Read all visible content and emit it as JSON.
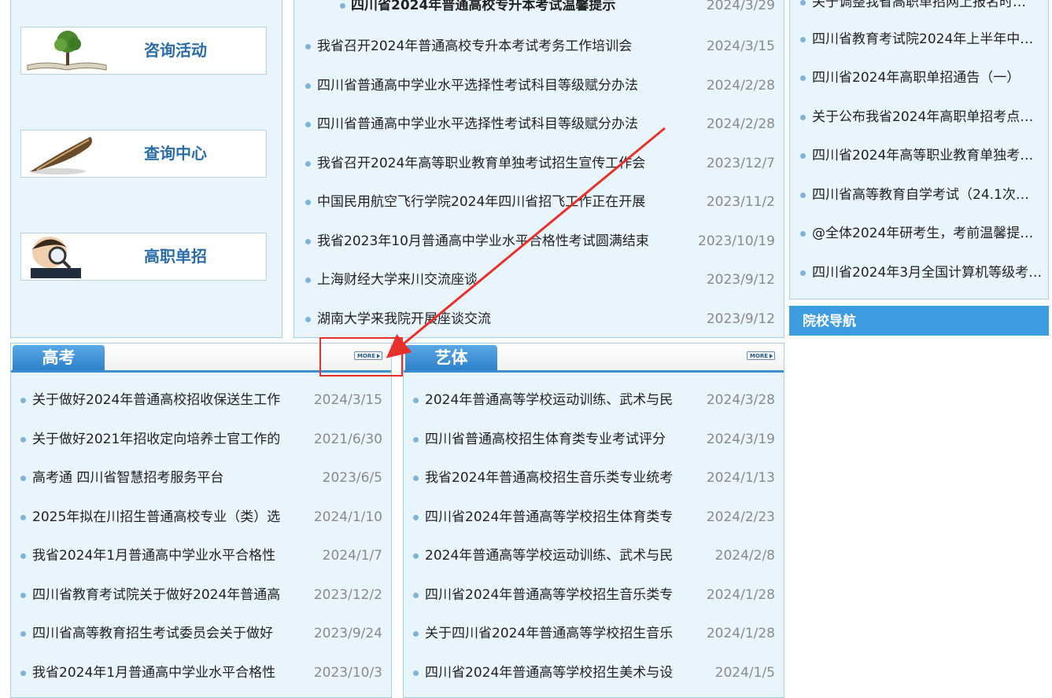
{
  "quick_links": [
    {
      "label": "咨询活动",
      "icon": "book-tree-icon"
    },
    {
      "label": "查询中心",
      "icon": "quill-pen-icon"
    },
    {
      "label": "高职单招",
      "icon": "magnifier-child-icon"
    }
  ],
  "center_news": {
    "cut_title": "四川省2024年普通高校专升本考试温馨提示",
    "cut_date": "2024/3/29",
    "items": [
      {
        "title": "我省召开2024年普通高校专升本考试考务工作培训会",
        "date": "2024/3/15"
      },
      {
        "title": "四川省普通高中学业水平选择性考试科目等级赋分办法",
        "date": "2024/2/28"
      },
      {
        "title": "四川省普通高中学业水平选择性考试科目等级赋分办法",
        "date": "2024/2/28"
      },
      {
        "title": "我省召开2024年高等职业教育单独考试招生宣传工作会",
        "date": "2023/12/7"
      },
      {
        "title": "中国民用航空飞行学院2024年四川省招飞工作正在开展",
        "date": "2023/11/2"
      },
      {
        "title": "我省2023年10月普通高中学业水平合格性考试圆满结束",
        "date": "2023/10/19"
      },
      {
        "title": "上海财经大学来川交流座谈",
        "date": "2023/9/12"
      },
      {
        "title": "湖南大学来我院开展座谈交流",
        "date": "2023/9/12"
      }
    ]
  },
  "right_news": {
    "cut_title": "关于调整我省高职单招网上报名时…",
    "items": [
      {
        "title": "四川省教育考试院2024年上半年中…"
      },
      {
        "title": "四川省2024年高职单招通告（一）"
      },
      {
        "title": "关于公布我省2024年高职单招考点…"
      },
      {
        "title": "四川省2024年高等职业教育单独考…"
      },
      {
        "title": "四川省高等教育自学考试（24.1次…"
      },
      {
        "title": "@全体2024年研考生，考前温馨提…"
      },
      {
        "title": "四川省2024年3月全国计算机等级考…"
      }
    ]
  },
  "school_nav": {
    "label": "院校导航"
  },
  "gaokao": {
    "tab": "高考",
    "more": "MORE",
    "items": [
      {
        "title": "关于做好2024年普通高校招收保送生工作",
        "date": "2024/3/15"
      },
      {
        "title": "关于做好2021年招收定向培养士官工作的",
        "date": "2021/6/30"
      },
      {
        "title": "高考通 四川省智慧招考服务平台",
        "date": "2023/6/5"
      },
      {
        "title": "2025年拟在川招生普通高校专业（类）选",
        "date": "2024/1/10"
      },
      {
        "title": "我省2024年1月普通高中学业水平合格性",
        "date": "2024/1/7"
      },
      {
        "title": "四川省教育考试院关于做好2024年普通高",
        "date": "2023/12/2"
      },
      {
        "title": "四川省高等教育招生考试委员会关于做好",
        "date": "2023/9/24"
      },
      {
        "title": "我省2024年1月普通高中学业水平合格性",
        "date": "2023/10/3"
      }
    ]
  },
  "yiti": {
    "tab": "艺体",
    "more": "MORE",
    "items": [
      {
        "title": "2024年普通高等学校运动训练、武术与民",
        "date": "2024/3/28"
      },
      {
        "title": "四川省普通高校招生体育类专业考试评分",
        "date": "2024/3/19"
      },
      {
        "title": "我省2024年普通高校招生音乐类专业统考",
        "date": "2024/1/13"
      },
      {
        "title": "四川省2024年普通高等学校招生体育类专",
        "date": "2024/2/23"
      },
      {
        "title": "2024年普通高等学校运动训练、武术与民",
        "date": "2024/2/8"
      },
      {
        "title": "四川省2024年普通高等学校招生音乐类专",
        "date": "2024/1/28"
      },
      {
        "title": "关于四川省2024年普通高等学校招生音乐",
        "date": "2024/1/28"
      },
      {
        "title": "四川省2024年普通高等学校招生美术与设",
        "date": "2024/1/5"
      }
    ]
  },
  "colors": {
    "accent": "#3d9be0",
    "annotation": "#e8302a",
    "panel_bg": "#e9f5fd"
  }
}
